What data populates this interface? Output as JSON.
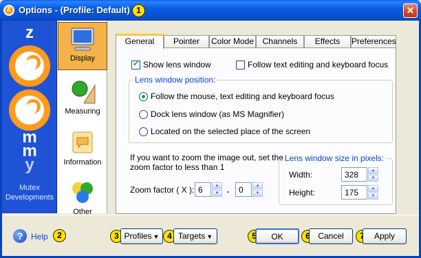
{
  "window": {
    "title": "Options - (Profile: Default)",
    "title_badge": "1",
    "close_glyph": "✕"
  },
  "logo": {
    "letters": [
      "z",
      "m",
      "m",
      "y"
    ],
    "company_line1": "Mutex",
    "company_line2": "Developments"
  },
  "categories": [
    {
      "label": "Display",
      "icon": "monitor-icon",
      "active": true
    },
    {
      "label": "Measuring",
      "icon": "measuring-icon",
      "active": false
    },
    {
      "label": "Information",
      "icon": "information-icon",
      "active": false
    },
    {
      "label": "Other",
      "icon": "other-icon",
      "active": false
    }
  ],
  "tabs": [
    {
      "label": "General",
      "active": true
    },
    {
      "label": "Pointer"
    },
    {
      "label": "Color Mode"
    },
    {
      "label": "Channels"
    },
    {
      "label": "Effects"
    },
    {
      "label": "Preferences"
    }
  ],
  "general": {
    "show_lens_window": {
      "label": "Show lens window",
      "checked": true
    },
    "follow_text_editing": {
      "label": "Follow text editing and keyboard focus",
      "checked": false
    },
    "lens_position": {
      "title": "Lens window position:",
      "options": [
        {
          "label": "Follow the mouse, text editing and keyboard focus",
          "selected": true
        },
        {
          "label": "Dock lens window (as MS Magnifier)",
          "selected": false
        },
        {
          "label": "Located on the selected place of the screen",
          "selected": false
        }
      ]
    },
    "zoom_hint_line1": "If you want to zoom the image out, set the",
    "zoom_hint_line2": "zoom factor to less than 1",
    "zoom_factor_label": "Zoom factor ( X ):",
    "zoom_integer": "6",
    "zoom_separator": ".",
    "zoom_fraction": "0",
    "lens_size": {
      "title": "Lens window size in pixels:",
      "width_label": "Width:",
      "width_value": "328",
      "height_label": "Height:",
      "height_value": "175"
    }
  },
  "bottom": {
    "help_label": "Help",
    "help_badge": "2",
    "profiles_label": "Profiles",
    "profiles_badge": "3",
    "targets_label": "Targets",
    "targets_badge": "4",
    "ok_label": "OK",
    "ok_badge": "5",
    "cancel_label": "Cancel",
    "cancel_badge": "6",
    "apply_label": "Apply",
    "apply_badge": "7"
  },
  "colors": {
    "titlebar": "#0a4fd0",
    "logo_bg": "#1f53d6",
    "logo_accent": "#ff9a1a",
    "badge": "#ffe100",
    "active_tab_accent": "#ffc83c",
    "group_title": "#0046d5"
  }
}
